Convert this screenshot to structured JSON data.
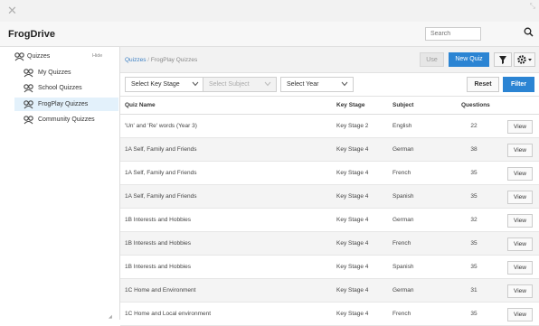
{
  "window": {
    "close_glyph": "✕",
    "resize_glyph": "⤡"
  },
  "app": {
    "title": "FrogDrive"
  },
  "search": {
    "placeholder": "Search"
  },
  "sidebar": {
    "root_label": "Quizzes",
    "hide_label": "Hide",
    "items": [
      {
        "label": "My Quizzes",
        "active": false
      },
      {
        "label": "School Quizzes",
        "active": false
      },
      {
        "label": "FrogPlay Quizzes",
        "active": true
      },
      {
        "label": "Community Quizzes",
        "active": false
      }
    ]
  },
  "breadcrumb": {
    "root": "Quizzes",
    "separator": "/",
    "current": "FrogPlay Quizzes"
  },
  "toolbar": {
    "use_label": "Use",
    "new_quiz_label": "New Quiz"
  },
  "filters": {
    "key_stage": "Select Key Stage",
    "subject": "Select Subject",
    "year": "Select Year",
    "reset_label": "Reset",
    "filter_label": "Filter"
  },
  "table": {
    "headers": {
      "name": "Quiz Name",
      "key_stage": "Key Stage",
      "subject": "Subject",
      "questions": "Questions"
    },
    "view_label": "View",
    "rows": [
      {
        "name": "'Un' and 'Re' words (Year 3)",
        "key_stage": "Key Stage 2",
        "subject": "English",
        "questions": "22"
      },
      {
        "name": "1A Self, Family and Friends",
        "key_stage": "Key Stage 4",
        "subject": "German",
        "questions": "38"
      },
      {
        "name": "1A Self, Family and Friends",
        "key_stage": "Key Stage 4",
        "subject": "French",
        "questions": "35"
      },
      {
        "name": "1A Self, Family and Friends",
        "key_stage": "Key Stage 4",
        "subject": "Spanish",
        "questions": "35"
      },
      {
        "name": "1B Interests and Hobbies",
        "key_stage": "Key Stage 4",
        "subject": "German",
        "questions": "32"
      },
      {
        "name": "1B Interests and Hobbies",
        "key_stage": "Key Stage 4",
        "subject": "French",
        "questions": "35"
      },
      {
        "name": "1B Interests and Hobbies",
        "key_stage": "Key Stage 4",
        "subject": "Spanish",
        "questions": "35"
      },
      {
        "name": "1C Home and Environment",
        "key_stage": "Key Stage 4",
        "subject": "German",
        "questions": "31"
      },
      {
        "name": "1C Home and Local environment",
        "key_stage": "Key Stage 4",
        "subject": "French",
        "questions": "35"
      }
    ]
  },
  "colors": {
    "accent": "#2b84d3",
    "active_bg": "#e3f1fb",
    "link": "#3a7fc4"
  }
}
